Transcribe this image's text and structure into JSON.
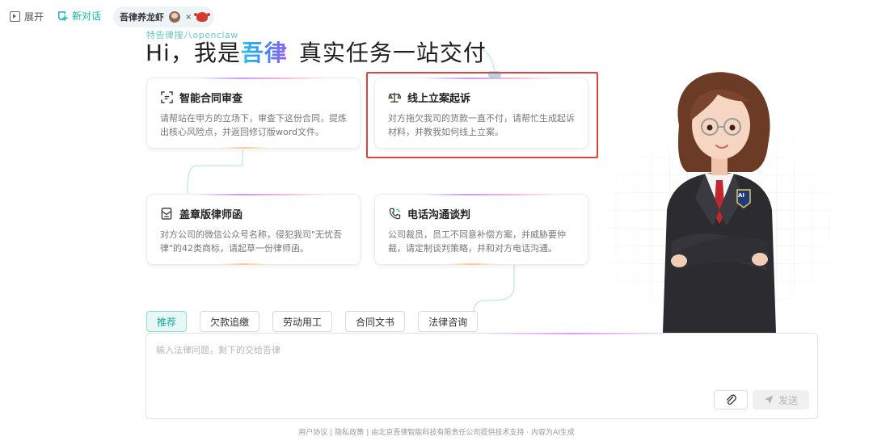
{
  "topbar": {
    "expand_label": "展开",
    "new_chat_label": "新对话",
    "tab_title": "吾律养龙虾"
  },
  "hero": {
    "subtitle": "特告律搜八openclaw",
    "greeting": "Hi，我是",
    "brand": "吾律",
    "tagline": "真实任务一站交付"
  },
  "cards": [
    {
      "icon": "scan-icon",
      "title": "智能合同审查",
      "desc": "请帮站在甲方的立场下，审查下这份合同，提炼出核心风险点，并返回修订版word文件。"
    },
    {
      "icon": "scales-icon",
      "title": "线上立案起诉",
      "desc": "对方拖欠我司的货款一直不付，请帮忙生成起诉材料，并教我如何线上立案。"
    },
    {
      "icon": "letter-icon",
      "title": "盖章版律师函",
      "desc": "对方公司的微信公众号名称，侵犯我司\"无忧吾律\"的42类商标，请起草一份律师函。"
    },
    {
      "icon": "phone-icon",
      "title": "电话沟通谈判",
      "desc": "公司裁员，员工不同意补偿方案，并威胁要仲裁，请定制谈判策略，并和对方电话沟通。"
    }
  ],
  "character_badge": "AI",
  "chips": [
    "推荐",
    "欠款追缴",
    "劳动用工",
    "合同文书",
    "法律咨询"
  ],
  "input": {
    "placeholder": "输入法律问题，剩下的交给吾律",
    "send_label": "发送"
  },
  "footer": {
    "user_agreement": "用户协议",
    "privacy": "隐私政策",
    "tech_support": "由北京吾律智能科技有限责任公司提供技术支持 · 内容为AI生成"
  },
  "colors": {
    "accent": "#19b3a7",
    "highlight": "#d9463e"
  }
}
